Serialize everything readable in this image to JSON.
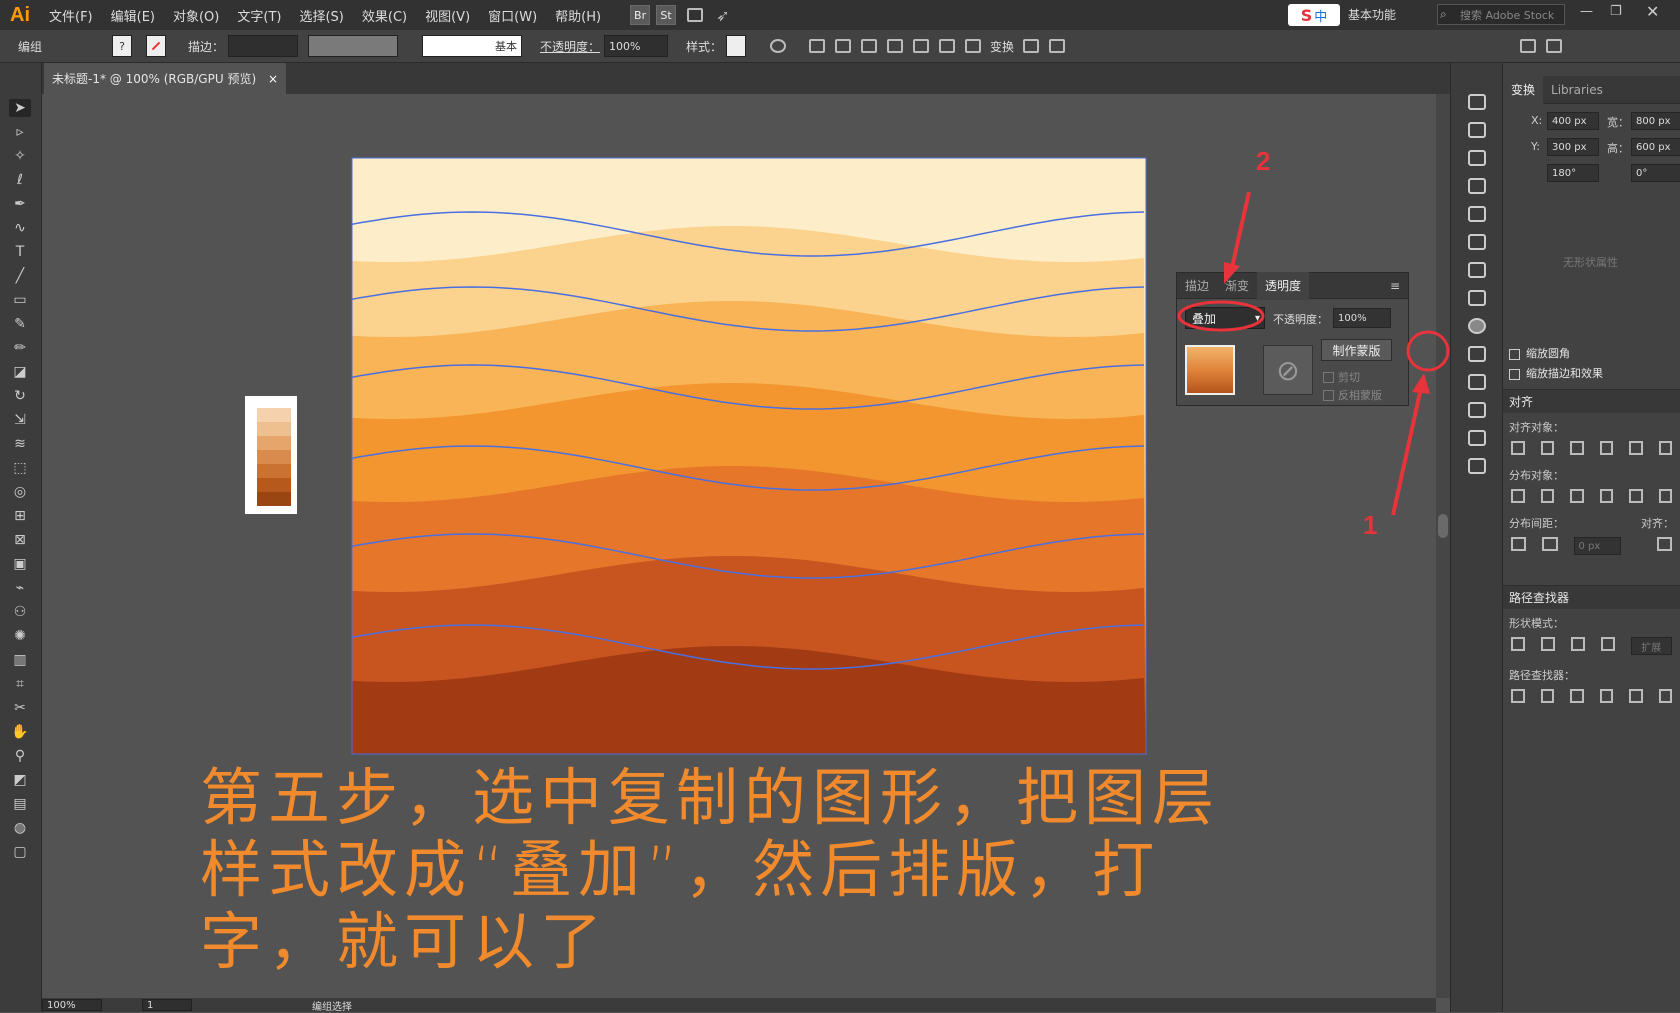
{
  "app": {
    "logo": "Ai",
    "workspace": "基本功能",
    "search_placeholder": "搜索 Adobe Stock",
    "ime_label": "中"
  },
  "menu": [
    "文件(F)",
    "编辑(E)",
    "对象(O)",
    "文字(T)",
    "选择(S)",
    "效果(C)",
    "视图(V)",
    "窗口(W)",
    "帮助(H)"
  ],
  "app_bar_buttons": [
    "Br",
    "St"
  ],
  "control": {
    "selection": "编组",
    "stroke_label": "描边：",
    "line_style": "基本",
    "opacity_label": "不透明度：",
    "opacity": "100%",
    "style_label": "样式：",
    "transform_btn": "变换"
  },
  "document": {
    "tab_title": "未标题-1* @ 100% (RGB/GPU 预览)",
    "close": "×"
  },
  "status": {
    "zoom": "100%",
    "page": "1",
    "mode": "编组选择"
  },
  "transparency_panel": {
    "tabs": [
      "描边",
      "渐变",
      "透明度"
    ],
    "blend_mode": "叠加",
    "opacity_label": "不透明度：",
    "opacity": "100%",
    "make_mask": "制作蒙版",
    "clip": "剪切",
    "invert_mask": "反相蒙版"
  },
  "transform_panel": {
    "tabs": [
      "变换",
      "Libraries"
    ],
    "x_label": "X:",
    "x": "400 px",
    "y_label": "Y:",
    "y": "300 px",
    "w_label": "宽：",
    "w": "800 px",
    "h_label": "高：",
    "h": "600 px",
    "angle": "180°",
    "shear": "0°",
    "no_shape": "无形状属性",
    "scale_corners": "缩放圆角",
    "scale_strokes": "缩放描边和效果"
  },
  "align_panel": {
    "title": "对齐",
    "align_objects": "对齐对象：",
    "distribute_objects": "分布对象：",
    "distribute_spacing": "分布间距：",
    "align_to": "对齐：",
    "spacing_value": "0 px"
  },
  "pathfinder_panel": {
    "title": "路径查找器",
    "shape_modes": "形状模式：",
    "pathfinders": "路径查找器：",
    "expand": "扩展"
  },
  "callouts": {
    "one": "1",
    "two": "2"
  },
  "caption": "第五步，选中复制的图形，把图层样式改成“叠加”，然后排版，打字，就可以了",
  "artwork": {
    "band_colors": [
      "#fdeec9",
      "#fbd38e",
      "#f8b456",
      "#f3962f",
      "#e6772a",
      "#c85420",
      "#a23a14"
    ],
    "swatch_colors": [
      "#f5d1ae",
      "#eebf8f",
      "#e5a56b",
      "#d98b4d",
      "#c97232",
      "#b55a1c",
      "#9a4612"
    ],
    "path_color": "#4a6fe0"
  }
}
